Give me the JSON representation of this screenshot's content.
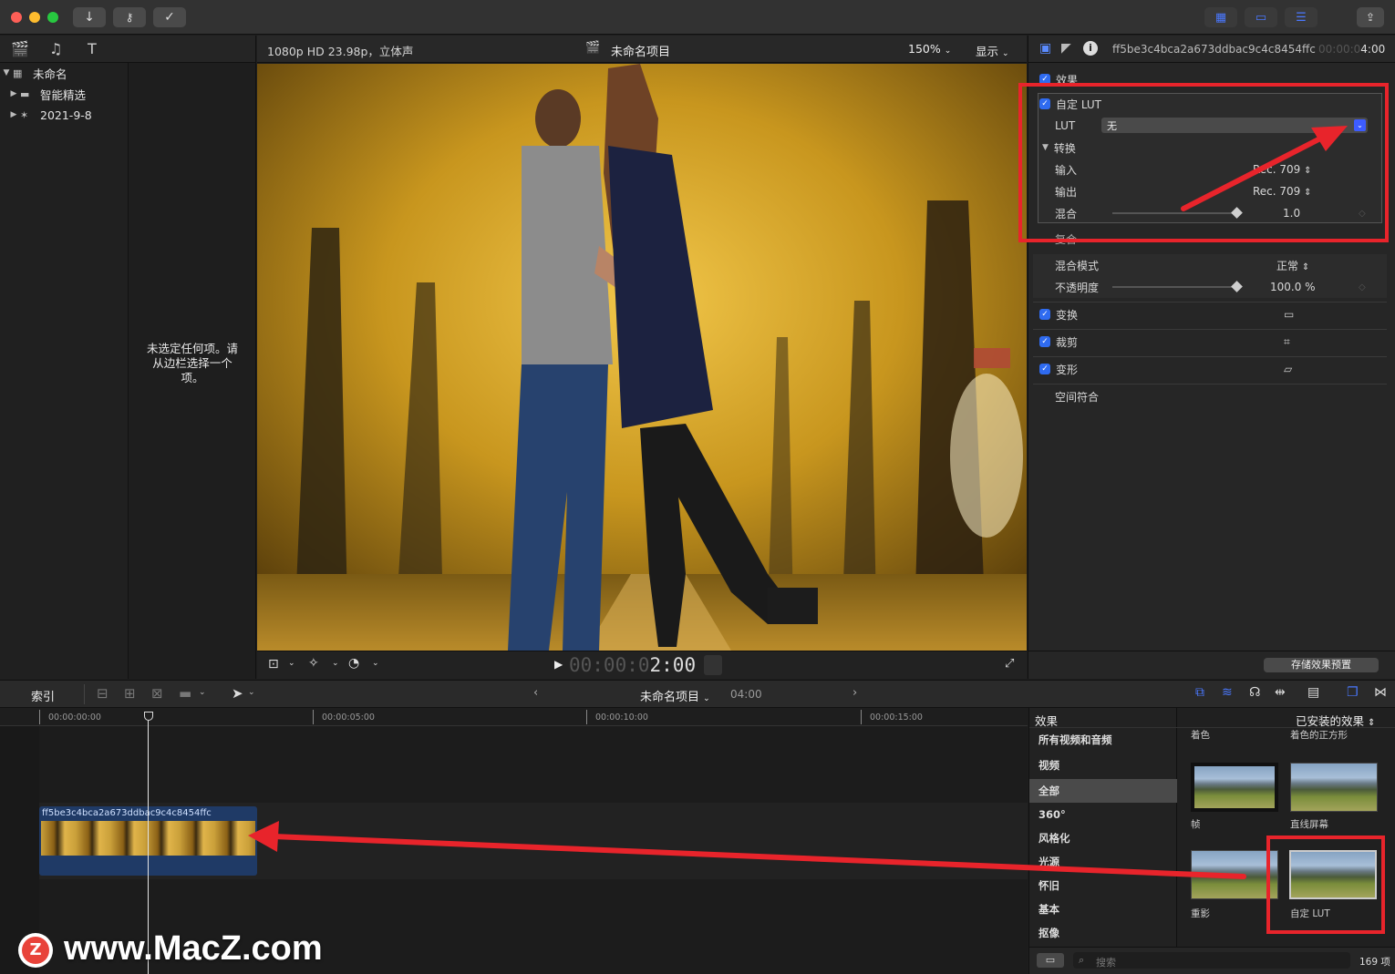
{
  "window": {
    "toolbar_right_icons": [
      "grid-layout-icon",
      "filmstrip-icon",
      "sliders-icon"
    ],
    "share_icon": "share-icon"
  },
  "library": {
    "event_name": "未命名",
    "items": [
      {
        "label": "智能精选"
      },
      {
        "label": "2021-9-8"
      }
    ],
    "empty_message": "未选定任何项。请从边栏选择一个项。"
  },
  "viewer": {
    "format": "1080p HD 23.98p，立体声",
    "project_title": "未命名项目",
    "zoom": "150%",
    "display_menu": "显示",
    "timecode_dim": "00:00:0",
    "timecode_bright": "2:00"
  },
  "inspector": {
    "clip_name": "ff5be3c4bca2a673ddbac9c4c8454ffc",
    "duration_dim": "00:00:0",
    "duration_bright": "4:00",
    "effects_section": "效果",
    "custom_lut": "自定 LUT",
    "lut_label": "LUT",
    "lut_value": "无",
    "transform_label": "转换",
    "input_label": "输入",
    "input_value": "Rec. 709",
    "output_label": "输出",
    "output_value": "Rec. 709",
    "mix_label": "混合",
    "mix_value": "1.0",
    "mix_fraction": 1.0,
    "composite_label": "复合",
    "blend_mode_label": "混合模式",
    "blend_mode_value": "正常",
    "opacity_label": "不透明度",
    "opacity_value": "100.0 %",
    "opacity_fraction": 1.0,
    "transform2": "变换",
    "crop": "裁剪",
    "distort": "变形",
    "spatial": "空间符合",
    "save_preset": "存储效果预置"
  },
  "timeline": {
    "index_label": "索引",
    "project_name": "未命名项目",
    "duration": "04:00",
    "ruler": [
      "00:00:00:00",
      "00:00:05:00",
      "00:00:10:00",
      "00:00:15:00"
    ],
    "clip_name": "ff5be3c4bca2a673ddbac9c4c8454ffc"
  },
  "effects_browser": {
    "header": "效果",
    "installed": "已安装的效果",
    "categories": [
      "所有视频和音频",
      "视频",
      "全部",
      "360°",
      "风格化",
      "光源",
      "怀旧",
      "基本",
      "抠像"
    ],
    "top_labels": [
      "着色",
      "着色的正方形"
    ],
    "thumbs": [
      "帧",
      "直线屏幕",
      "重影",
      "自定 LUT"
    ],
    "search_placeholder": "搜索",
    "count": "169 项"
  },
  "watermark": {
    "text": "www.MacZ.com"
  },
  "colors": {
    "accent": "#2f6bf0",
    "highlight_red": "#e8242b"
  }
}
